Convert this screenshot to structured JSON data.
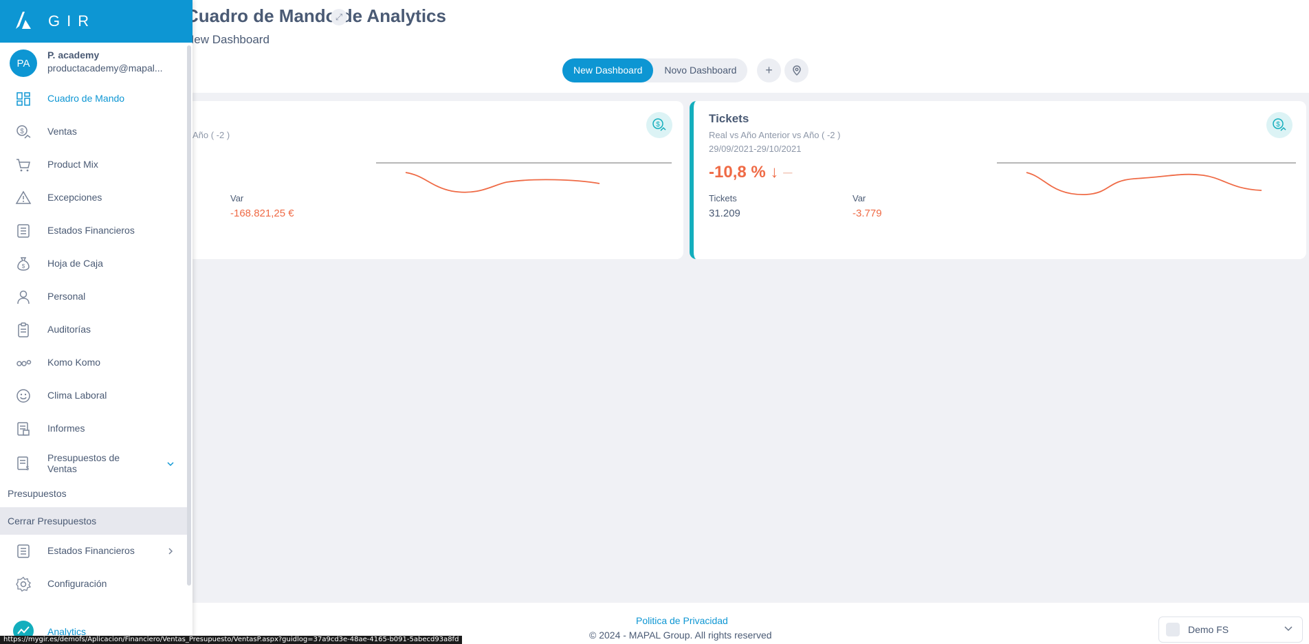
{
  "header": {
    "title": "Cuadro de Mando de Analytics",
    "subtitle": "New Dashboard",
    "tabs": [
      "New Dashboard",
      "Novo Dashboard"
    ],
    "add_icon": "plus-icon",
    "pin_icon": "location-pin-icon",
    "expand_icon": "expand-icon"
  },
  "cards": [
    {
      "subtitle": "Año ( -2 )",
      "var_label": "Var",
      "var_value": "-168.821,25 €",
      "icon": "money-trend-icon"
    },
    {
      "title": "Tickets",
      "subtitle": "Real vs Año Anterior vs Año ( -2 )",
      "date_range": "29/09/2021-29/10/2021",
      "big_value": "-10,8 %",
      "trend": "↓",
      "tickets_label": "Tickets",
      "tickets_value": "31.209",
      "var_label": "Var",
      "var_value": "-3.779",
      "icon": "money-trend-icon"
    }
  ],
  "footer": {
    "privacy": "Politica de Privacidad",
    "copyright": "© 2024 - MAPAL Group. All rights reserved",
    "company": "Demo FS"
  },
  "sidebar": {
    "brand": "GIR",
    "user": {
      "initials": "PA",
      "name": "P. academy",
      "email": "productacademy@mapal..."
    },
    "items": [
      {
        "label": "Cuadro de Mando",
        "icon": "dashboard-grid-icon"
      },
      {
        "label": "Ventas",
        "icon": "sales-coin-icon"
      },
      {
        "label": "Product Mix",
        "icon": "cart-icon"
      },
      {
        "label": "Excepciones",
        "icon": "warning-icon"
      },
      {
        "label": "Estados Financieros",
        "icon": "report-icon"
      },
      {
        "label": "Hoja de Caja",
        "icon": "money-bag-icon"
      },
      {
        "label": "Personal",
        "icon": "person-icon"
      },
      {
        "label": "Auditorías",
        "icon": "clipboard-icon"
      },
      {
        "label": "Komo Komo",
        "icon": "komo-icon"
      },
      {
        "label": "Clima Laboral",
        "icon": "smile-icon"
      },
      {
        "label": "Informes",
        "icon": "document-icon"
      },
      {
        "label": "Presupuestos de Ventas",
        "label_line1": "Presupuestos de",
        "label_line2": "Ventas",
        "icon": "budget-icon"
      }
    ],
    "subitems": [
      "Presupuestos",
      "Cerrar Presupuestos"
    ],
    "items_after": [
      {
        "label": "Estados Financieros",
        "icon": "report-icon"
      },
      {
        "label": "Configuración",
        "icon": "gear-icon"
      },
      {
        "label": "Analytics",
        "icon": "analytics-icon"
      }
    ]
  },
  "status_url": "https://mygir.es/demofs/Aplicacion/Financiero/Ventas_Presupuesto/VentasP.aspx?guidlog=37a9cd3e-48ae-4165-b091-5abecd93a8fd",
  "colors": {
    "accent": "#0d96d3",
    "negative": "#ef6a45",
    "teal": "#13aebd"
  }
}
